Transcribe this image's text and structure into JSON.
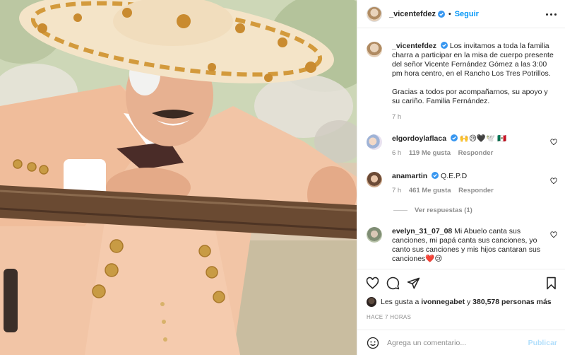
{
  "post": {
    "username": "_vicentefdez",
    "follow_label": "Seguir",
    "separator": "•"
  },
  "caption": {
    "username": "_vicentefdez",
    "text_1": "Los invitamos a toda la familia charra a participar en la misa de cuerpo presente del señor Vicente Fernández Gómez a las 3:00 pm hora centro, en el Rancho Los Tres Potrillos.",
    "text_2": "Gracias a todos por acompañarnos, su apoyo y su cariño. Familia Fernández.",
    "time": "7 h"
  },
  "comments": [
    {
      "username": "elgordoylaflaca",
      "text": "🙌😢🖤🕊️ 🇲🇽",
      "time": "6 h",
      "likes": "119 Me gusta",
      "reply": "Responder"
    },
    {
      "username": "anamartin",
      "text": "Q.E.P.D",
      "time": "7 h",
      "likes": "461 Me gusta",
      "reply": "Responder"
    },
    {
      "username": "evelyn_31_07_08",
      "text": "Mi Abuelo canta sus canciones, mi papá canta sus canciones, yo canto sus canciones y mis hijos cantaran sus canciones❤️😢",
      "time": "",
      "likes": "",
      "reply": ""
    }
  ],
  "view_replies": "Ver respuestas (1)",
  "likes": {
    "prefix": "Les gusta a",
    "user": "ivonnegabet",
    "middle": "y",
    "count": "380,578 personas más"
  },
  "timestamp": "HACE 7 HORAS",
  "composer": {
    "placeholder": "Agrega un comentario...",
    "publish_label": "Publicar"
  },
  "colors": {
    "accent": "#0095f6",
    "verified": "#3897f0",
    "publish_disabled": "#b2dffc"
  },
  "icons": [
    "verified-badge-icon",
    "more-options-icon",
    "heart-icon",
    "comment-icon",
    "share-icon",
    "bookmark-icon",
    "emoji-icon"
  ]
}
